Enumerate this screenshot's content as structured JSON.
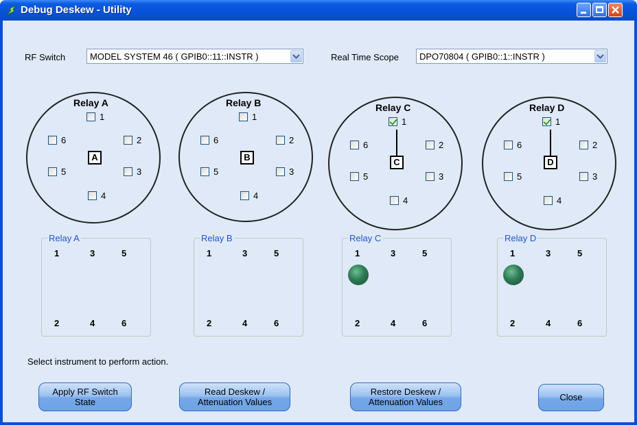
{
  "window": {
    "title": "Debug Deskew - Utility"
  },
  "rf_switch": {
    "label": "RF Switch",
    "value": "MODEL SYSTEM 46 ( GPIB0::11::INSTR )"
  },
  "scope": {
    "label": "Real Time Scope",
    "value": "DPO70804 ( GPIB0::1::INSTR )"
  },
  "relays": [
    {
      "title": "Relay A",
      "center": "A",
      "checked": []
    },
    {
      "title": "Relay B",
      "center": "B",
      "checked": []
    },
    {
      "title": "Relay C",
      "center": "C",
      "checked": [
        1
      ]
    },
    {
      "title": "Relay D",
      "center": "D",
      "checked": [
        1
      ]
    }
  ],
  "port_labels": [
    "1",
    "2",
    "3",
    "4",
    "5",
    "6"
  ],
  "indicator_groups": [
    {
      "title": "Relay A",
      "active": []
    },
    {
      "title": "Relay B",
      "active": []
    },
    {
      "title": "Relay C",
      "active": [
        1
      ]
    },
    {
      "title": "Relay D",
      "active": [
        1
      ]
    }
  ],
  "status": "Select instrument to perform action.",
  "buttons": {
    "apply": [
      "Apply RF Switch",
      "State"
    ],
    "read": [
      "Read Deskew /",
      "Attenuation Values"
    ],
    "restore": [
      "Restore Deskew /",
      "Attenuation Values"
    ],
    "close": "Close"
  },
  "colors": {
    "accent": "#2155cc",
    "led_on": "#2e7a55",
    "panel_bg": "#dfe9f7"
  }
}
